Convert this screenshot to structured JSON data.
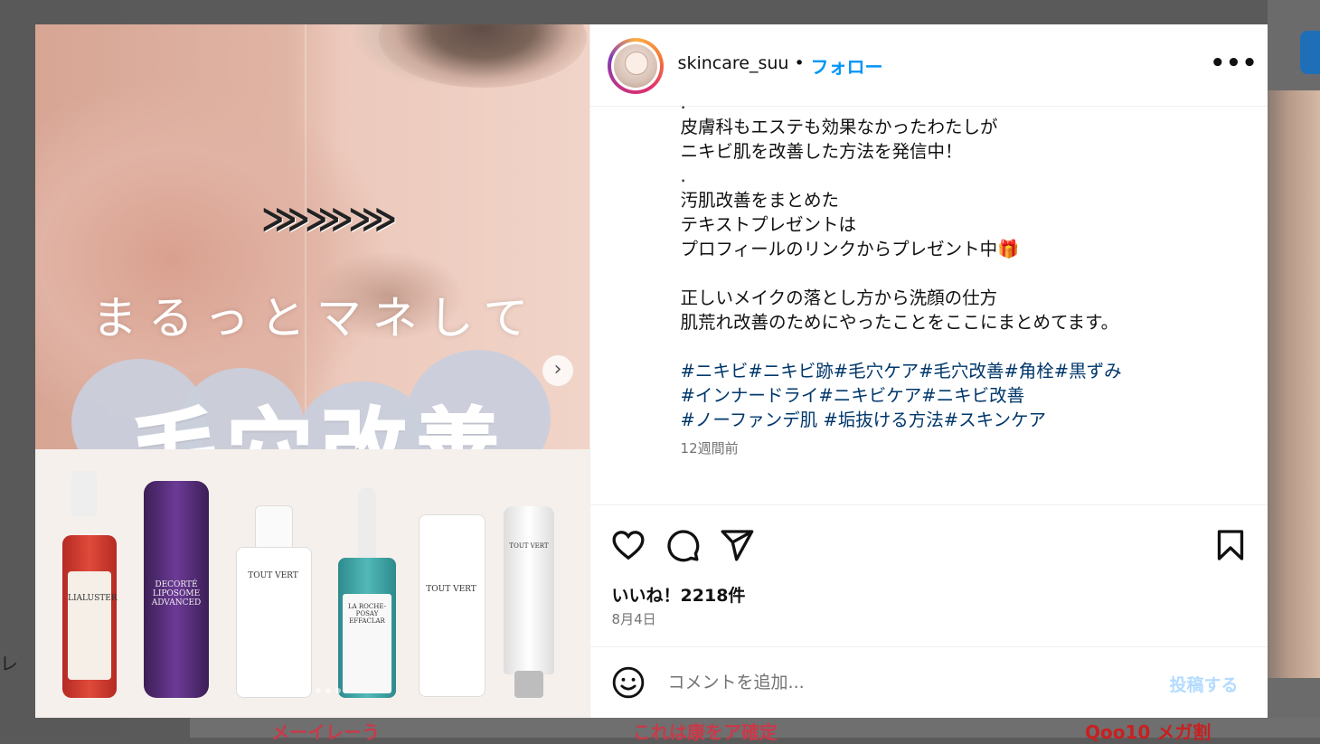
{
  "background": {
    "left_text": "レ",
    "bottom_texts": [
      "メーイレーう",
      "これは康をア確定",
      "Qoo10 メガ割"
    ]
  },
  "post": {
    "media": {
      "headline": "まるっとマネして",
      "big_title": "毛穴改善",
      "arrows": "⋙⋙⋙",
      "products": [
        "LIALUSTER",
        "DECORTÉ LIPOSOME ADVANCED",
        "TOUT VERT",
        "LA ROCHE-POSAY EFFACLAR",
        "TOUT VERT",
        "TOUT VERT"
      ],
      "slide_count": 9,
      "active_slide": 1
    },
    "header": {
      "username": "skincare_suu",
      "separator": "•",
      "follow_label": "フォロー",
      "more_label": "•••"
    },
    "caption": {
      "lines": [
        ".",
        "皮膚科もエステも効果なかったわたしが",
        "ニキビ肌を改善した方法を発信中！",
        ".",
        "汚肌改善をまとめた",
        "テキストプレゼントは",
        "プロフィールのリンクからプレゼント中🎁",
        "",
        "正しいメイクの落とし方から洗顔の仕方",
        "肌荒れ改善のためにやったことをここにまとめてます。",
        ""
      ],
      "hashtag_lines": [
        "#ニキビ#ニキビ跡#毛穴ケア#毛穴改善#角栓#黒ずみ",
        "#インナードライ#ニキビケア#ニキビ改善",
        "#ノーファンデ肌 #垢抜ける方法#スキンケア"
      ],
      "time_ago": "12週間前"
    },
    "likes_label": "いいね！2218件",
    "date": "8月4日",
    "comment": {
      "placeholder": "コメントを追加...",
      "post_label": "投稿する"
    }
  },
  "colors": {
    "accent": "#0095f6",
    "hashtag": "#00376b",
    "muted": "#737373",
    "post_disabled": "#b3dbff"
  }
}
